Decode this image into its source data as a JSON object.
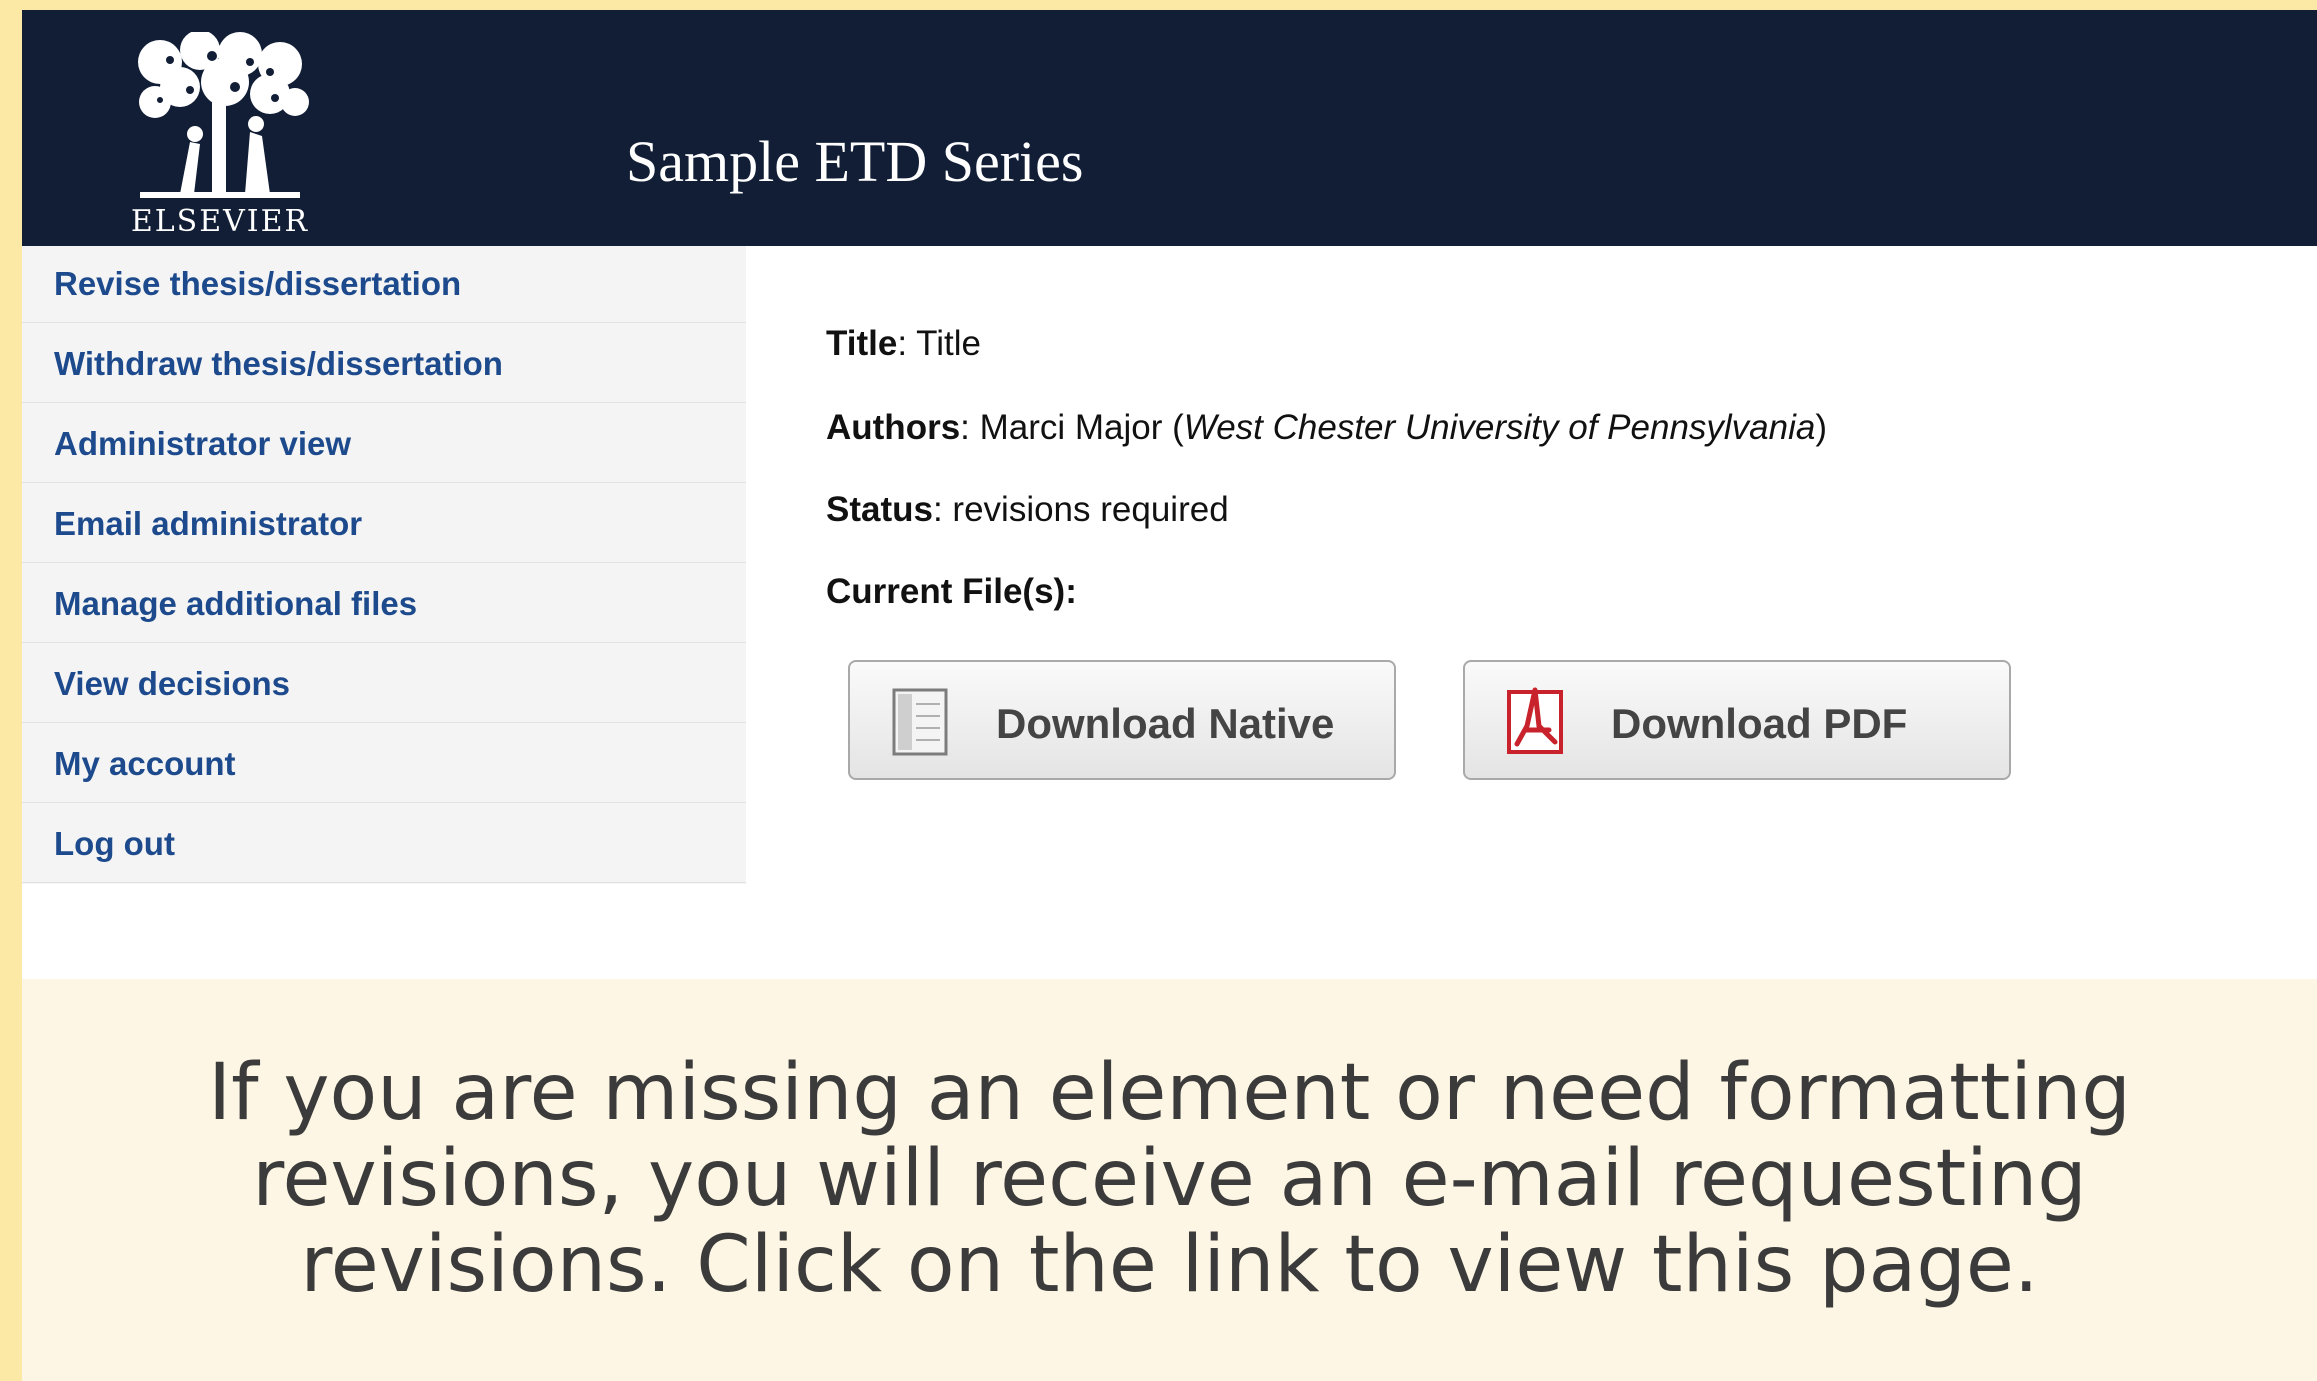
{
  "header": {
    "logo_text": "ELSEVIER",
    "series_title": "Sample ETD Series"
  },
  "sidebar": {
    "items": [
      {
        "label": "Revise thesis/dissertation"
      },
      {
        "label": "Withdraw thesis/dissertation"
      },
      {
        "label": "Administrator view"
      },
      {
        "label": "Email administrator"
      },
      {
        "label": "Manage additional files"
      },
      {
        "label": "View decisions"
      },
      {
        "label": "My account"
      },
      {
        "label": "Log out"
      }
    ]
  },
  "record": {
    "title_label": "Title",
    "title_value": "Title",
    "authors_label": "Authors",
    "author_name": "Marci Major",
    "author_affiliation": "West Chester University of Pennsylvania",
    "status_label": "Status",
    "status_value": "revisions required",
    "files_label": "Current File(s):"
  },
  "buttons": {
    "native": {
      "label": "Download Native",
      "icon": "document-icon"
    },
    "pdf": {
      "label": "Download PDF",
      "icon": "pdf-icon"
    }
  },
  "caption": {
    "lines": [
      "If you are missing an element or need formatting",
      "revisions, you will receive an e-mail requesting",
      "revisions. Click on the link to view this page."
    ]
  },
  "colors": {
    "header_bg": "#111e36",
    "link": "#1d4a8c",
    "outer_bg": "#fce9a6",
    "caption_bg": "#fdf6e4"
  }
}
